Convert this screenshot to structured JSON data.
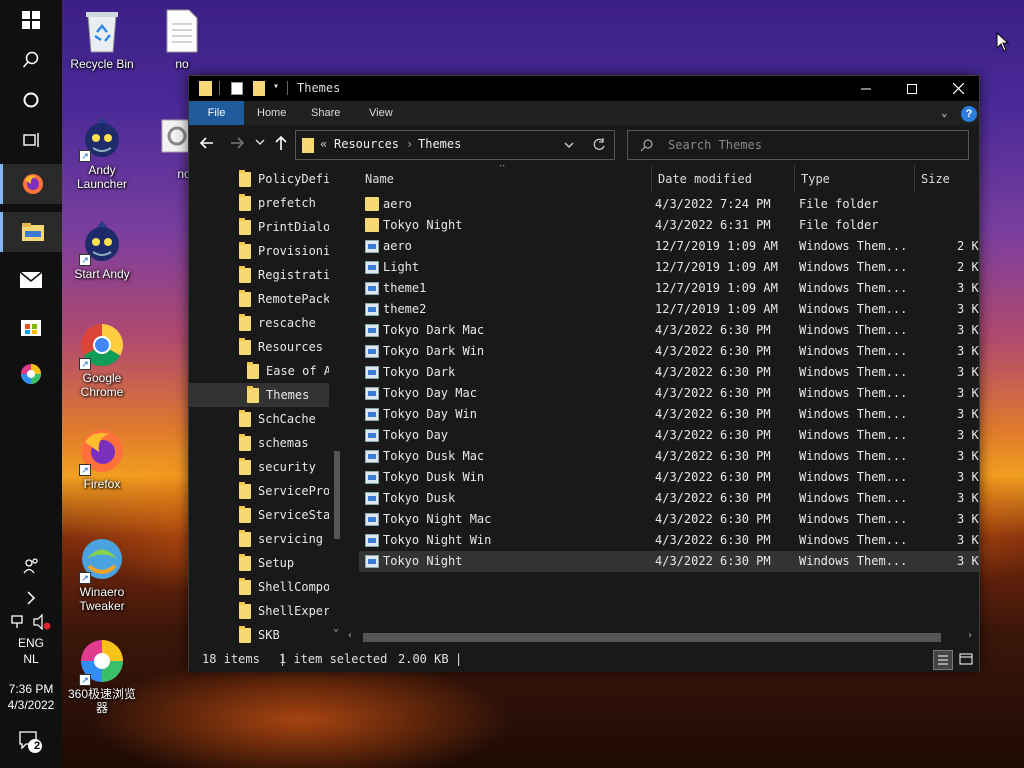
{
  "taskbar": {
    "tray": {
      "lang1": "ENG",
      "lang2": "NL",
      "time": "7:36 PM",
      "date": "4/3/2022",
      "notification_count": "2"
    }
  },
  "desktop": {
    "icons": [
      {
        "label": "Recycle Bin",
        "icon": "recycle-bin-icon"
      },
      {
        "label": "no",
        "icon": "text-file-icon"
      },
      {
        "label": "no",
        "icon": "settings-file-icon"
      },
      {
        "label": "Andy Launcher",
        "icon": "andy-icon"
      },
      {
        "label": "Start Andy",
        "icon": "andy-icon"
      },
      {
        "label": "Google Chrome",
        "icon": "chrome-icon"
      },
      {
        "label": "Firefox",
        "icon": "firefox-icon"
      },
      {
        "label": "Winaero Tweaker",
        "icon": "winaero-icon"
      },
      {
        "label": "360极速浏览器",
        "icon": "360-browser-icon"
      }
    ]
  },
  "window": {
    "title": "Themes",
    "ribbon_tabs": [
      "File",
      "Home",
      "Share",
      "View"
    ],
    "breadcrumb": {
      "prefix": "«",
      "items": [
        "Resources",
        "Themes"
      ]
    },
    "search_placeholder": "Search Themes",
    "nav_tree": [
      {
        "label": "PolicyDefinitions",
        "selected": false,
        "indent": 0
      },
      {
        "label": "prefetch",
        "selected": false,
        "indent": 0
      },
      {
        "label": "PrintDialog",
        "selected": false,
        "indent": 0
      },
      {
        "label": "Provisioning",
        "selected": false,
        "indent": 0
      },
      {
        "label": "Registration",
        "selected": false,
        "indent": 0
      },
      {
        "label": "RemotePackages",
        "selected": false,
        "indent": 0
      },
      {
        "label": "rescache",
        "selected": false,
        "indent": 0
      },
      {
        "label": "Resources",
        "selected": false,
        "indent": 0
      },
      {
        "label": "Ease of Access Themes",
        "selected": false,
        "indent": 1
      },
      {
        "label": "Themes",
        "selected": true,
        "indent": 1
      },
      {
        "label": "SchCache",
        "selected": false,
        "indent": 0
      },
      {
        "label": "schemas",
        "selected": false,
        "indent": 0
      },
      {
        "label": "security",
        "selected": false,
        "indent": 0
      },
      {
        "label": "ServiceProfiles",
        "selected": false,
        "indent": 0
      },
      {
        "label": "ServiceState",
        "selected": false,
        "indent": 0
      },
      {
        "label": "servicing",
        "selected": false,
        "indent": 0
      },
      {
        "label": "Setup",
        "selected": false,
        "indent": 0
      },
      {
        "label": "ShellComponents",
        "selected": false,
        "indent": 0
      },
      {
        "label": "ShellExperiences",
        "selected": false,
        "indent": 0
      },
      {
        "label": "SKB",
        "selected": false,
        "indent": 0
      }
    ],
    "columns": [
      "Name",
      "Date modified",
      "Type",
      "Size"
    ],
    "files": [
      {
        "name": "aero",
        "date": "4/3/2022 7:24 PM",
        "type": "File folder",
        "size": "",
        "kind": "folder",
        "selected": false
      },
      {
        "name": "Tokyo Night",
        "date": "4/3/2022 6:31 PM",
        "type": "File folder",
        "size": "",
        "kind": "folder",
        "selected": false
      },
      {
        "name": "aero",
        "date": "12/7/2019 1:09 AM",
        "type": "Windows Them...",
        "size": "2 K",
        "kind": "theme",
        "selected": false
      },
      {
        "name": "Light",
        "date": "12/7/2019 1:09 AM",
        "type": "Windows Them...",
        "size": "2 K",
        "kind": "theme",
        "selected": false
      },
      {
        "name": "theme1",
        "date": "12/7/2019 1:09 AM",
        "type": "Windows Them...",
        "size": "3 K",
        "kind": "theme",
        "selected": false
      },
      {
        "name": "theme2",
        "date": "12/7/2019 1:09 AM",
        "type": "Windows Them...",
        "size": "3 K",
        "kind": "theme",
        "selected": false
      },
      {
        "name": "Tokyo Dark Mac",
        "date": "4/3/2022 6:30 PM",
        "type": "Windows Them...",
        "size": "3 K",
        "kind": "theme",
        "selected": false
      },
      {
        "name": "Tokyo Dark Win",
        "date": "4/3/2022 6:30 PM",
        "type": "Windows Them...",
        "size": "3 K",
        "kind": "theme",
        "selected": false
      },
      {
        "name": "Tokyo Dark",
        "date": "4/3/2022 6:30 PM",
        "type": "Windows Them...",
        "size": "3 K",
        "kind": "theme",
        "selected": false
      },
      {
        "name": "Tokyo Day Mac",
        "date": "4/3/2022 6:30 PM",
        "type": "Windows Them...",
        "size": "3 K",
        "kind": "theme",
        "selected": false
      },
      {
        "name": "Tokyo Day Win",
        "date": "4/3/2022 6:30 PM",
        "type": "Windows Them...",
        "size": "3 K",
        "kind": "theme",
        "selected": false
      },
      {
        "name": "Tokyo Day",
        "date": "4/3/2022 6:30 PM",
        "type": "Windows Them...",
        "size": "3 K",
        "kind": "theme",
        "selected": false
      },
      {
        "name": "Tokyo Dusk Mac",
        "date": "4/3/2022 6:30 PM",
        "type": "Windows Them...",
        "size": "3 K",
        "kind": "theme",
        "selected": false
      },
      {
        "name": "Tokyo Dusk Win",
        "date": "4/3/2022 6:30 PM",
        "type": "Windows Them...",
        "size": "3 K",
        "kind": "theme",
        "selected": false
      },
      {
        "name": "Tokyo Dusk",
        "date": "4/3/2022 6:30 PM",
        "type": "Windows Them...",
        "size": "3 K",
        "kind": "theme",
        "selected": false
      },
      {
        "name": "Tokyo Night Mac",
        "date": "4/3/2022 6:30 PM",
        "type": "Windows Them...",
        "size": "3 K",
        "kind": "theme",
        "selected": false
      },
      {
        "name": "Tokyo Night Win",
        "date": "4/3/2022 6:30 PM",
        "type": "Windows Them...",
        "size": "3 K",
        "kind": "theme",
        "selected": false
      },
      {
        "name": "Tokyo Night",
        "date": "4/3/2022 6:30 PM",
        "type": "Windows Them...",
        "size": "3 K",
        "kind": "theme",
        "selected": true
      }
    ],
    "status": {
      "items": "18 items",
      "selected": "1 item selected",
      "size": "2.00 KB",
      "separator": "|"
    }
  },
  "colors": {
    "accent": "#1f5a9c",
    "window_bg": "#191919",
    "folder": "#f8d775"
  }
}
